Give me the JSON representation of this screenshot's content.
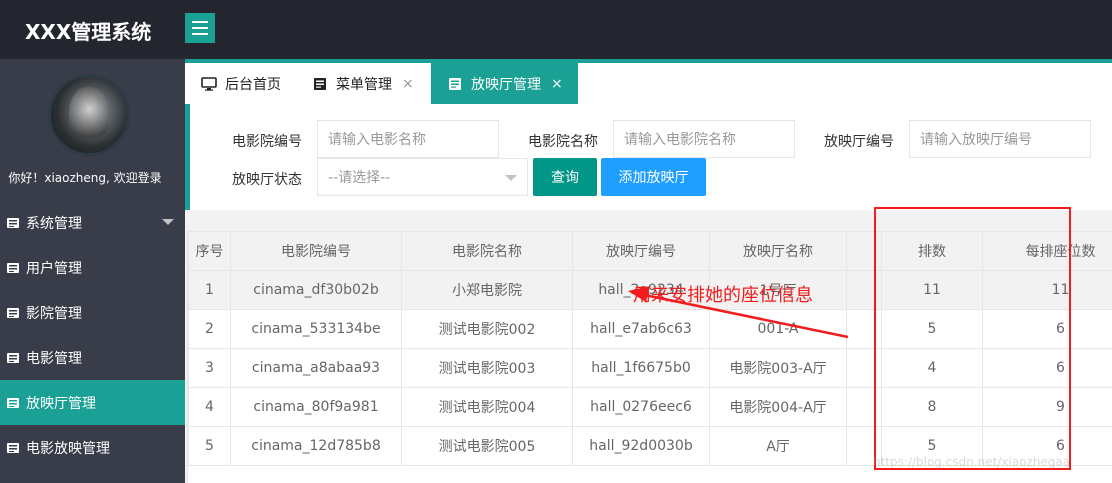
{
  "app": {
    "title": "XXX管理系统"
  },
  "sidebar": {
    "welcome": "你好！xiaozheng, 欢迎登录",
    "items": [
      {
        "label": "系统管理",
        "icon": "list-icon"
      },
      {
        "label": "用户管理",
        "icon": "list-icon"
      },
      {
        "label": "影院管理",
        "icon": "list-icon"
      },
      {
        "label": "电影管理",
        "icon": "list-icon"
      },
      {
        "label": "放映厅管理",
        "icon": "list-icon",
        "active": true
      },
      {
        "label": "电影放映管理",
        "icon": "list-icon"
      }
    ]
  },
  "tabs": [
    {
      "label": "后台首页",
      "icon": "monitor-icon"
    },
    {
      "label": "菜单管理",
      "icon": "list-icon",
      "close": "×"
    },
    {
      "label": "放映厅管理",
      "icon": "list-icon",
      "close": "×",
      "active": true
    }
  ],
  "filters": {
    "cinema_no_label": "电影院编号",
    "cinema_no_placeholder": "请输入电影名称",
    "cinema_name_label": "电影院名称",
    "cinema_name_placeholder": "请输入电影院名称",
    "hall_no_label": "放映厅编号",
    "hall_no_placeholder": "请输入放映厅编号",
    "hall_status_label": "放映厅状态",
    "hall_status_value": "--请选择--",
    "query_button": "查询",
    "add_button": "添加放映厅"
  },
  "table": {
    "headers": [
      "序号",
      "电影院编号",
      "电影院名称",
      "放映厅编号",
      "放映厅名称",
      "",
      "排数",
      "每排座位数"
    ],
    "rows": [
      [
        "1",
        "cinama_df30b02b",
        "小郑电影院",
        "hall_2a9234",
        "1号厅",
        "",
        "11",
        "11"
      ],
      [
        "2",
        "cinama_533134be",
        "测试电影院002",
        "hall_e7ab6c63",
        "001-A",
        "",
        "5",
        "6"
      ],
      [
        "3",
        "cinama_a8abaa93",
        "测试电影院003",
        "hall_1f6675b0",
        "电影院003-A厅",
        "",
        "4",
        "6"
      ],
      [
        "4",
        "cinama_80f9a981",
        "测试电影院004",
        "hall_0276eec6",
        "电影院004-A厅",
        "",
        "8",
        "9"
      ],
      [
        "5",
        "cinama_12d785b8",
        "测试电影院005",
        "hall_92d0030b",
        "A厅",
        "",
        "5",
        "6"
      ]
    ]
  },
  "annotation": {
    "text": "用来安排她的座位信息",
    "color": "#f21c1c"
  },
  "watermark": "https://blog.csdn.net/xiaozhegaa",
  "colors": {
    "accent": "#1aa094",
    "topbar": "#23262e",
    "sidebar": "#393d49",
    "query": "#009688",
    "add": "#1e9fff"
  }
}
